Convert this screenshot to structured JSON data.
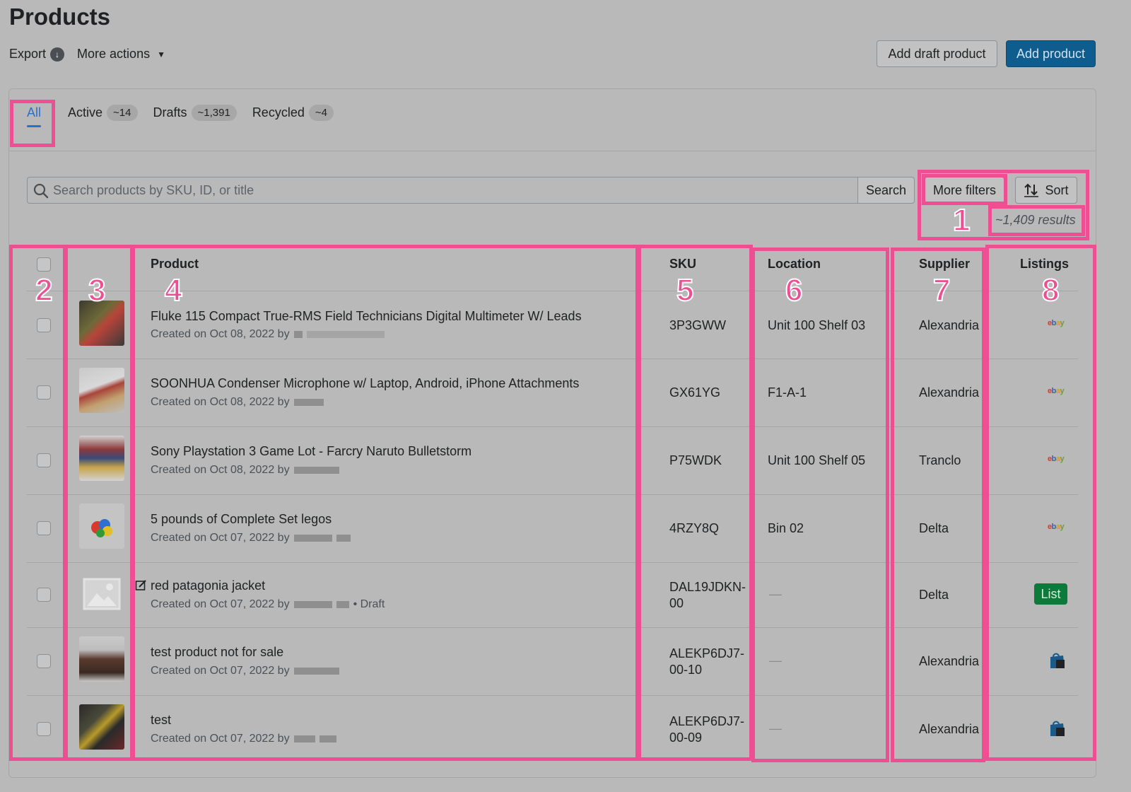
{
  "page": {
    "title": "Products"
  },
  "toolbar": {
    "export_label": "Export",
    "more_actions_label": "More actions",
    "add_draft_label": "Add draft product",
    "add_product_label": "Add product"
  },
  "tabs": [
    {
      "label": "All",
      "count": ""
    },
    {
      "label": "Active",
      "count": "~14"
    },
    {
      "label": "Drafts",
      "count": "~1,391"
    },
    {
      "label": "Recycled",
      "count": "~4"
    }
  ],
  "search": {
    "placeholder": "Search products by SKU, ID, or title",
    "button_label": "Search"
  },
  "filters": {
    "more_filters_label": "More filters",
    "sort_label": "Sort",
    "results": "~1,409 results"
  },
  "table": {
    "headers": {
      "product": "Product",
      "sku": "SKU",
      "location": "Location",
      "supplier": "Supplier",
      "listings": "Listings"
    },
    "rows": [
      {
        "title": "Fluke 115 Compact True-RMS Field Technicians Digital Multimeter W/ Leads",
        "created": "Created on Oct 08, 2022 by",
        "status": "",
        "sku": "3P3GWW",
        "location": "Unit 100 Shelf 03",
        "supplier": "Alexandria",
        "listing": "ebay"
      },
      {
        "title": "SOONHUA Condenser Microphone w/ Laptop, Android, iPhone Attachments",
        "created": "Created on Oct 08, 2022 by",
        "status": "",
        "sku": "GX61YG",
        "location": "F1-A-1",
        "supplier": "Alexandria",
        "listing": "ebay"
      },
      {
        "title": "Sony Playstation 3 Game Lot - Farcry Naruto Bulletstorm",
        "created": "Created on Oct 08, 2022 by",
        "status": "",
        "sku": "P75WDK",
        "location": "Unit 100 Shelf 05",
        "supplier": "Tranclo",
        "listing": "ebay"
      },
      {
        "title": "5 pounds of Complete Set legos",
        "created": "Created on Oct 07, 2022 by",
        "status": "",
        "sku": "4RZY8Q",
        "location": "Bin 02",
        "supplier": "Delta",
        "listing": "ebay"
      },
      {
        "title": "red patagonia jacket",
        "created": "Created on Oct 07, 2022 by",
        "status": "• Draft",
        "sku": "DAL19JDKN-00",
        "sku_line1": "DAL19JDKN-",
        "sku_line2": "00",
        "location": "—",
        "supplier": "Delta",
        "listing": "List"
      },
      {
        "title": "test product not for sale",
        "created": "Created on Oct 07, 2022 by",
        "status": "",
        "sku": "ALEKP6DJ7-00-10",
        "sku_line1": "ALEKP6DJ7-",
        "sku_line2": "00-10",
        "location": "—",
        "supplier": "Alexandria",
        "listing": "shop"
      },
      {
        "title": "test",
        "created": "Created on Oct 07, 2022 by",
        "status": "",
        "sku": "ALEKP6DJ7-00-09",
        "sku_line1": "ALEKP6DJ7-",
        "sku_line2": "00-09",
        "location": "—",
        "supplier": "Alexandria",
        "listing": "shop"
      }
    ]
  },
  "annotations": [
    "1",
    "2",
    "3",
    "4",
    "5",
    "6",
    "7",
    "8"
  ],
  "colors": {
    "highlight": "#ee4f93",
    "primary": "#0f5c8e",
    "list_button": "#0b7a3a",
    "tab_active": "#2c6ecb"
  },
  "icons": {
    "export": "download-circle-icon",
    "search": "search-icon",
    "sort": "sort-arrows-icon",
    "draft": "edit-icon",
    "shop": "shopping-bag-icon",
    "placeholder_image": "image-placeholder-icon"
  }
}
